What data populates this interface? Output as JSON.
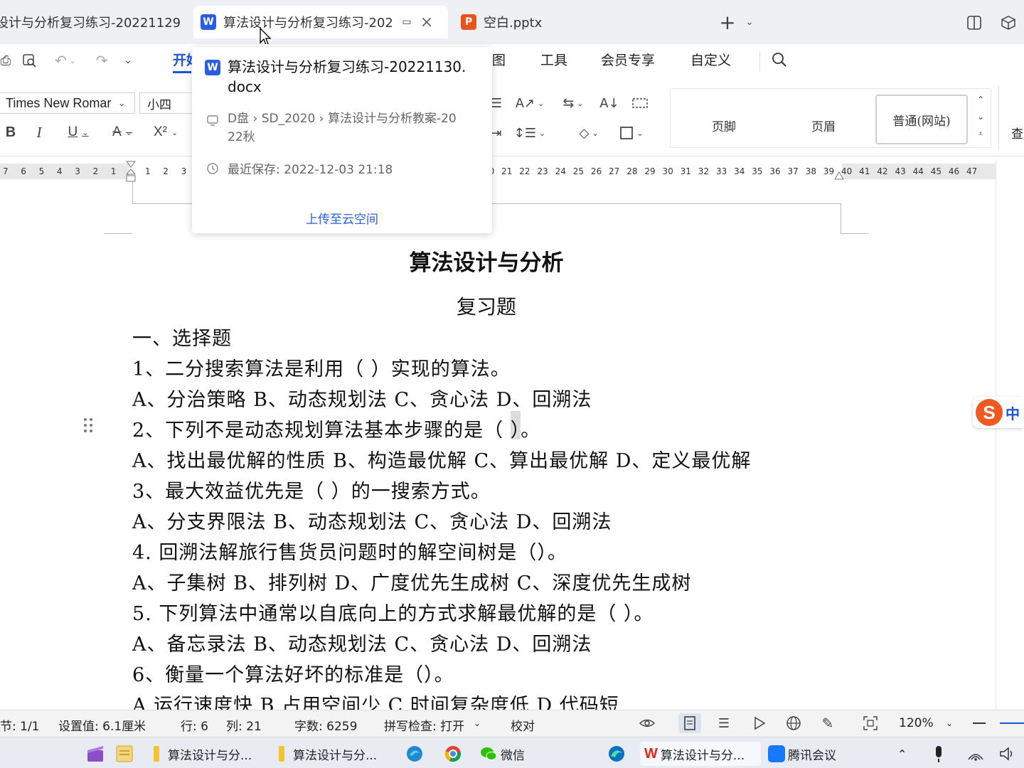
{
  "tabs": [
    {
      "label": "设计与分析复习练习-20221129",
      "icon": "word-doc-icon"
    },
    {
      "label": "算法设计与分析复习练习-202",
      "icon": "wps-writer-icon",
      "icon_text": "W",
      "active": true
    },
    {
      "label": "空白.pptx",
      "icon": "wps-presentation-icon",
      "icon_text": "P"
    }
  ],
  "menu": {
    "start": "开始",
    "view": "图",
    "tools": "工具",
    "member": "会员专享",
    "custom": "自定义"
  },
  "ribbon": {
    "font_name": "Times New Romar",
    "font_size": "小四",
    "styles": [
      "页脚",
      "页眉",
      "普通(网站)"
    ],
    "find_label": "查"
  },
  "ruler": {
    "left_numbers": [
      "7",
      "6",
      "5",
      "4",
      "3",
      "2",
      "1",
      "1",
      "2",
      "3"
    ],
    "right_numbers": [
      "20",
      "21",
      "22",
      "23",
      "24",
      "25",
      "26",
      "27",
      "28",
      "29",
      "30",
      "31",
      "32",
      "33",
      "34",
      "35",
      "36",
      "37",
      "38",
      "39",
      "40",
      "41",
      "42",
      "43",
      "44",
      "45",
      "46",
      "47"
    ]
  },
  "popup": {
    "filename": "算法设计与分析复习练习-20221130.docx",
    "filename_line1": "算法设计与分析复习练习-20221130.",
    "filename_line2": "docx",
    "path_line1": "D盘 › SD_2020 › 算法设计与分析教案-20",
    "path_line2": "22秋",
    "saved": "最近保存: 2022-12-03 21:18",
    "upload": "上传至云空间"
  },
  "document": {
    "title": "算法设计与分析",
    "subtitle": "复习题",
    "lines": [
      "一、选择题",
      "1、二分搜索算法是利用（  ）实现的算法。",
      "A、分治策略  B、动态规划法  C、贪心法  D、回溯法",
      "2、下列不是动态规划算法基本步骤的是（  ）。",
      "A、找出最优解的性质  B、构造最优解  C、算出最优解  D、定义最优解",
      "3、最大效益优先是（  ）的一搜索方式。",
      "A、分支界限法  B、动态规划法  C、贪心法  D、回溯法",
      "4.  回溯法解旅行售货员问题时的解空间树是（）。",
      "A、子集树  B、排列树  D、广度优先生成树  C、深度优先生成树",
      "5.  下列算法中通常以自底向上的方式求解最优解的是（  ）。",
      "A、备忘录法  B、动态规划法  C、贪心法  D、回溯法",
      "6、衡量一个算法好坏的标准是（）。",
      "A  运行速度快  B  占用空间少  C  时间复杂度低  D  代码短"
    ]
  },
  "ime": {
    "label": "中"
  },
  "statusbar": {
    "section": "节: 1/1",
    "setting": "设置值: 6.1厘米",
    "row": "行: 6",
    "col": "列: 21",
    "wordcount": "字数: 6259",
    "spellcheck": "拼写检查: 打开",
    "proofread": "校对",
    "zoom": "120%"
  },
  "taskbar": {
    "items": [
      {
        "label": "算法设计与分...",
        "icon": "folder-icon"
      },
      {
        "label": "算法设计与分...",
        "icon": "folder-icon"
      },
      {
        "label": "微信",
        "icon": "wechat-icon"
      },
      {
        "label": "算法设计与分...",
        "icon": "wps-icon"
      },
      {
        "label": "腾讯会议",
        "icon": "tencent-meeting-icon"
      }
    ]
  },
  "colors": {
    "wps_blue": "#2b5ce6",
    "ppt_orange": "#e8541e",
    "tabbar_bg": "#eef0f4",
    "accent_blue": "#1a56db",
    "sogou_orange": "#f05a22"
  }
}
